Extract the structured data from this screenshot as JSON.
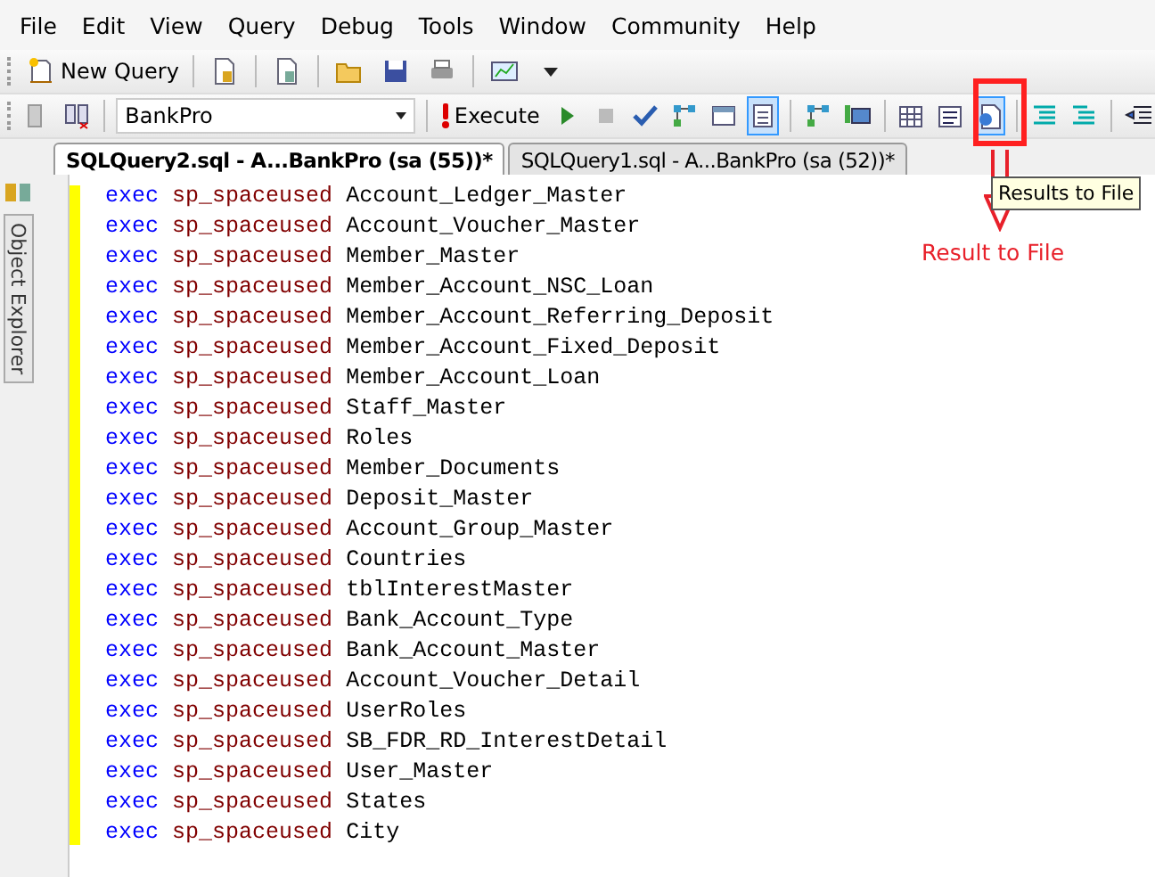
{
  "menu": [
    "File",
    "Edit",
    "View",
    "Query",
    "Debug",
    "Tools",
    "Window",
    "Community",
    "Help"
  ],
  "toolbar": {
    "new_query": "New Query"
  },
  "query_toolbar": {
    "database": "BankPro",
    "execute": "Execute",
    "buttons": [
      {
        "kind": "grid",
        "selected": false
      },
      {
        "kind": "text",
        "selected": false
      },
      {
        "kind": "file",
        "selected": true
      }
    ]
  },
  "tabs": [
    {
      "label": "SQLQuery2.sql - A...BankPro (sa (55))*",
      "selected": true
    },
    {
      "label": "SQLQuery1.sql - A...BankPro (sa (52))*",
      "selected": false
    }
  ],
  "sidebar": {
    "label": "Object Explorer"
  },
  "tooltip": "Results to File",
  "annotation": "Result to File",
  "lines": [
    {
      "keyword": "exec",
      "procedure": "sp_spaceused",
      "table": "Account_Ledger_Master"
    },
    {
      "keyword": "exec",
      "procedure": "sp_spaceused",
      "table": "Account_Voucher_Master"
    },
    {
      "keyword": "exec",
      "procedure": "sp_spaceused",
      "table": "Member_Master"
    },
    {
      "keyword": "exec",
      "procedure": "sp_spaceused",
      "table": "Member_Account_NSC_Loan"
    },
    {
      "keyword": "exec",
      "procedure": "sp_spaceused",
      "table": "Member_Account_Referring_Deposit"
    },
    {
      "keyword": "exec",
      "procedure": "sp_spaceused",
      "table": "Member_Account_Fixed_Deposit"
    },
    {
      "keyword": "exec",
      "procedure": "sp_spaceused",
      "table": "Member_Account_Loan"
    },
    {
      "keyword": "exec",
      "procedure": "sp_spaceused",
      "table": "Staff_Master"
    },
    {
      "keyword": "exec",
      "procedure": "sp_spaceused",
      "table": "Roles"
    },
    {
      "keyword": "exec",
      "procedure": "sp_spaceused",
      "table": "Member_Documents"
    },
    {
      "keyword": "exec",
      "procedure": "sp_spaceused",
      "table": "Deposit_Master"
    },
    {
      "keyword": "exec",
      "procedure": "sp_spaceused",
      "table": "Account_Group_Master"
    },
    {
      "keyword": "exec",
      "procedure": "sp_spaceused",
      "table": "Countries"
    },
    {
      "keyword": "exec",
      "procedure": "sp_spaceused",
      "table": "tblInterestMaster"
    },
    {
      "keyword": "exec",
      "procedure": "sp_spaceused",
      "table": "Bank_Account_Type"
    },
    {
      "keyword": "exec",
      "procedure": "sp_spaceused",
      "table": "Bank_Account_Master"
    },
    {
      "keyword": "exec",
      "procedure": "sp_spaceused",
      "table": "Account_Voucher_Detail"
    },
    {
      "keyword": "exec",
      "procedure": "sp_spaceused",
      "table": "UserRoles"
    },
    {
      "keyword": "exec",
      "procedure": "sp_spaceused",
      "table": "SB_FDR_RD_InterestDetail"
    },
    {
      "keyword": "exec",
      "procedure": "sp_spaceused",
      "table": "User_Master"
    },
    {
      "keyword": "exec",
      "procedure": "sp_spaceused",
      "table": "States"
    },
    {
      "keyword": "exec",
      "procedure": "sp_spaceused",
      "table": "City"
    }
  ]
}
